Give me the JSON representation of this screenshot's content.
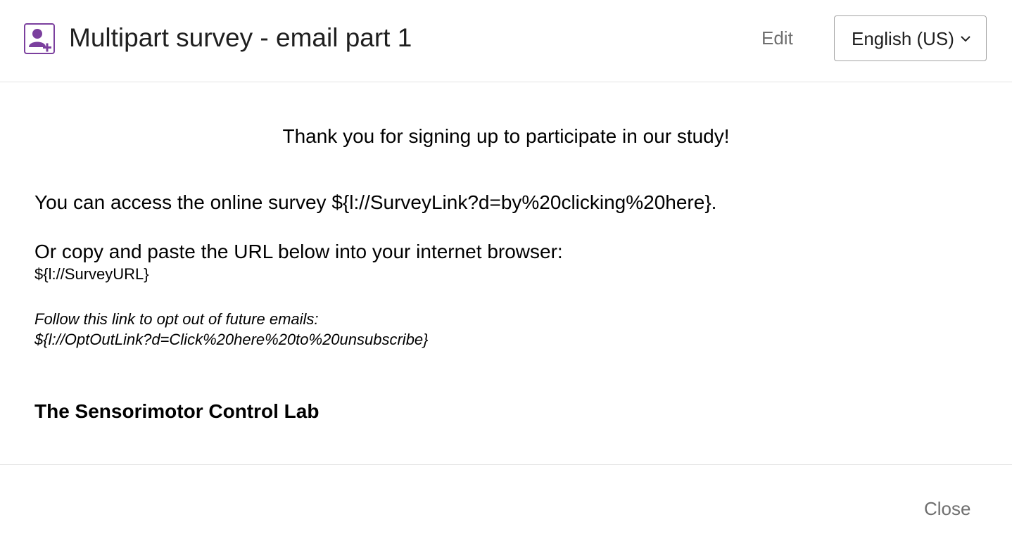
{
  "header": {
    "icon": "contact-add-icon",
    "title": "Multipart survey - email part 1",
    "edit_label": "Edit",
    "language": "English (US)"
  },
  "message": {
    "greeting": "Thank you for signing up to participate in our study!",
    "access_line": "You can access the online survey ${l://SurveyLink?d=by%20clicking%20here}.",
    "copy_line": "Or copy and paste the URL below into your internet browser:",
    "survey_url": "${l://SurveyURL}",
    "optout_text": "Follow this link to opt out of future emails:",
    "optout_link": "${l://OptOutLink?d=Click%20here%20to%20unsubscribe}",
    "signature": "The Sensorimotor Control Lab"
  },
  "footer": {
    "close_label": "Close"
  },
  "colors": {
    "accent_purple": "#7b3f9e",
    "muted_text": "#6f6f6f",
    "divider": "#e4e4e4"
  }
}
